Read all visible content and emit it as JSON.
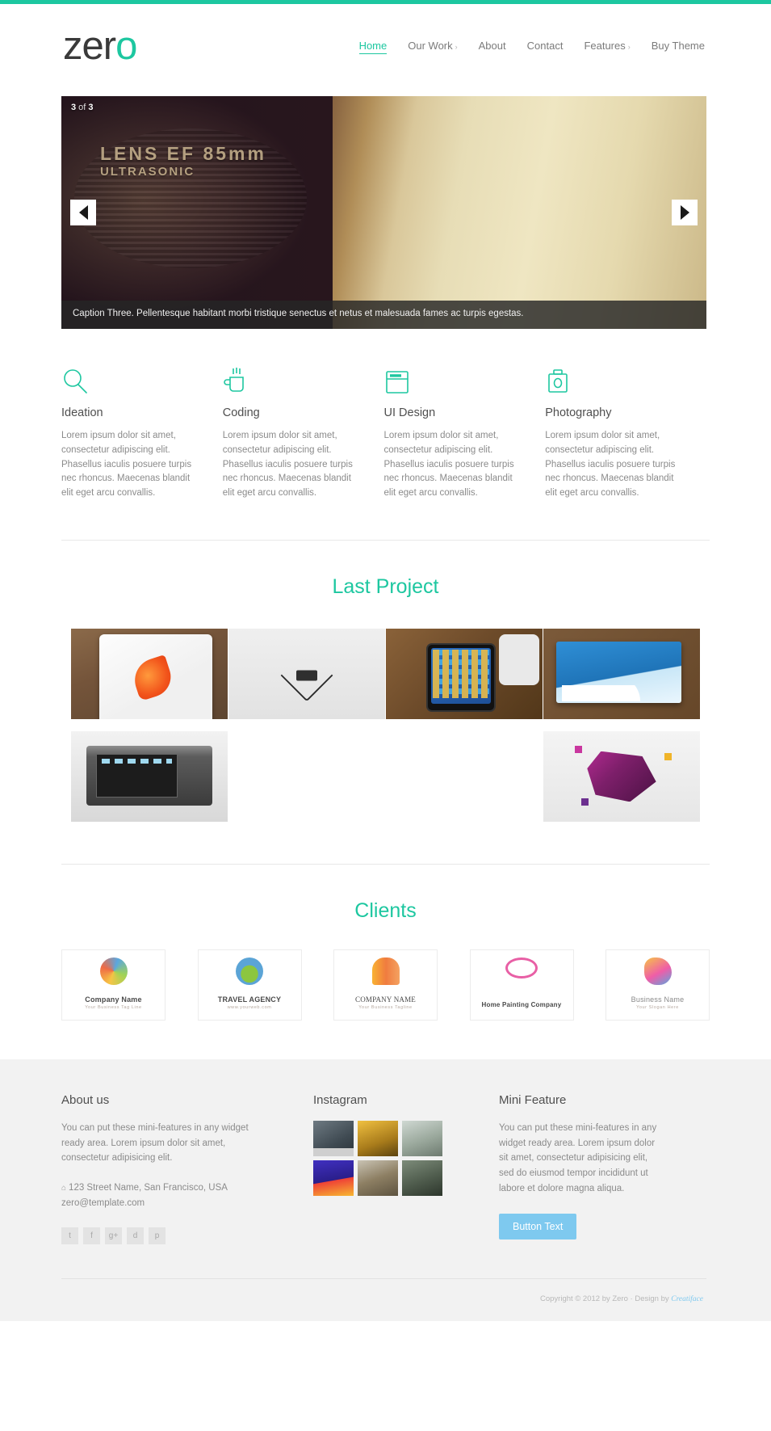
{
  "brand": {
    "text_dark": "zer",
    "text_accent": "o",
    "accent_color": "#1dc7a0"
  },
  "nav": {
    "items": [
      {
        "label": "Home",
        "caret": "",
        "active": true
      },
      {
        "label": "Our Work",
        "caret": "›",
        "active": false
      },
      {
        "label": "About",
        "caret": "",
        "active": false
      },
      {
        "label": "Contact",
        "caret": "",
        "active": false
      },
      {
        "label": "Features",
        "caret": "›",
        "active": false
      },
      {
        "label": "Buy Theme",
        "caret": "",
        "active": false
      }
    ]
  },
  "slider": {
    "counter_current": "3",
    "counter_of": " of ",
    "counter_total": "3",
    "lens_label": "LENS  EF",
    "lens_focal": "85mm",
    "lens_sub": "ULTRASONIC",
    "prev_icon": "left-arrow-icon",
    "next_icon": "right-arrow-icon",
    "caption": "Caption Three. Pellentesque habitant morbi tristique senectus et netus et malesuada fames ac turpis egestas."
  },
  "features": {
    "items": [
      {
        "icon": "search-icon",
        "title": "Ideation",
        "body": "Lorem ipsum dolor sit amet, consectetur adipiscing elit. Phasellus iaculis posuere turpis nec rhoncus. Maecenas blandit elit eget arcu convallis."
      },
      {
        "icon": "coffee-cup-icon",
        "title": "Coding",
        "body": "Lorem ipsum dolor sit amet, consectetur adipiscing elit. Phasellus iaculis posuere turpis nec rhoncus. Maecenas blandit elit eget arcu convallis."
      },
      {
        "icon": "browser-window-icon",
        "title": "UI Design",
        "body": "Lorem ipsum dolor sit amet, consectetur adipiscing elit. Phasellus iaculis posuere turpis nec rhoncus. Maecenas blandit elit eget arcu convallis."
      },
      {
        "icon": "camera-icon",
        "title": "Photography",
        "body": "Lorem ipsum dolor sit amet, consectetur adipiscing elit. Phasellus iaculis posuere turpis nec rhoncus. Maecenas blandit elit eget arcu convallis."
      }
    ]
  },
  "portfolio": {
    "title": "Last Project",
    "items": [
      {
        "name": "tablet-sketch-thumb"
      },
      {
        "name": "gamepad-heart-thumb"
      },
      {
        "name": "iphone-desk-thumb"
      },
      {
        "name": "business-card-thumb"
      },
      {
        "name": "camera-back-thumb"
      },
      {
        "name": "abstract-3d-thumb"
      }
    ]
  },
  "clients": {
    "title": "Clients",
    "items": [
      {
        "name": "Company Name",
        "sub": "Your Business Tag Line",
        "art": "blob1"
      },
      {
        "name": "TRAVEL AGENCY",
        "sub": "www.yourweb.com",
        "art": "blob2"
      },
      {
        "name": "COMPANY NAME",
        "sub": "Your Business Tagline",
        "art": "blob3"
      },
      {
        "name": "Home Painting Company",
        "sub": "",
        "art": "blob4"
      },
      {
        "name": "Business Name",
        "sub": "Your Slogan Here",
        "art": "blob5"
      }
    ]
  },
  "footer": {
    "about": {
      "heading": "About us",
      "text": "You can put these mini-features in any widget ready area. Lorem ipsum dolor sit amet, consectetur adipisicing elit.",
      "address": "123 Street Name, San Francisco, USA",
      "email": "zero@template.com",
      "pin_icon": "location-pin-icon",
      "socials": [
        {
          "label": "t",
          "name": "twitter-icon"
        },
        {
          "label": "f",
          "name": "facebook-icon"
        },
        {
          "label": "g+",
          "name": "googleplus-icon"
        },
        {
          "label": "d",
          "name": "dribbble-icon"
        },
        {
          "label": "p",
          "name": "pinterest-icon"
        }
      ]
    },
    "instagram": {
      "heading": "Instagram",
      "photos": [
        {
          "name": "instagram-photo-1"
        },
        {
          "name": "instagram-photo-2"
        },
        {
          "name": "instagram-photo-3"
        },
        {
          "name": "instagram-photo-4"
        },
        {
          "name": "instagram-photo-5"
        },
        {
          "name": "instagram-photo-6"
        }
      ]
    },
    "mini": {
      "heading": "Mini Feature",
      "text": "You can put these mini-features in any widget ready area. Lorem ipsum dolor sit amet, consectetur adipisicing elit, sed do eiusmod tempor incididunt ut labore et dolore magna aliqua.",
      "button_label": "Button Text"
    },
    "copyright_text": "Copyright © 2012 by Zero · Design by ",
    "copyright_brand": "Creatiface"
  }
}
